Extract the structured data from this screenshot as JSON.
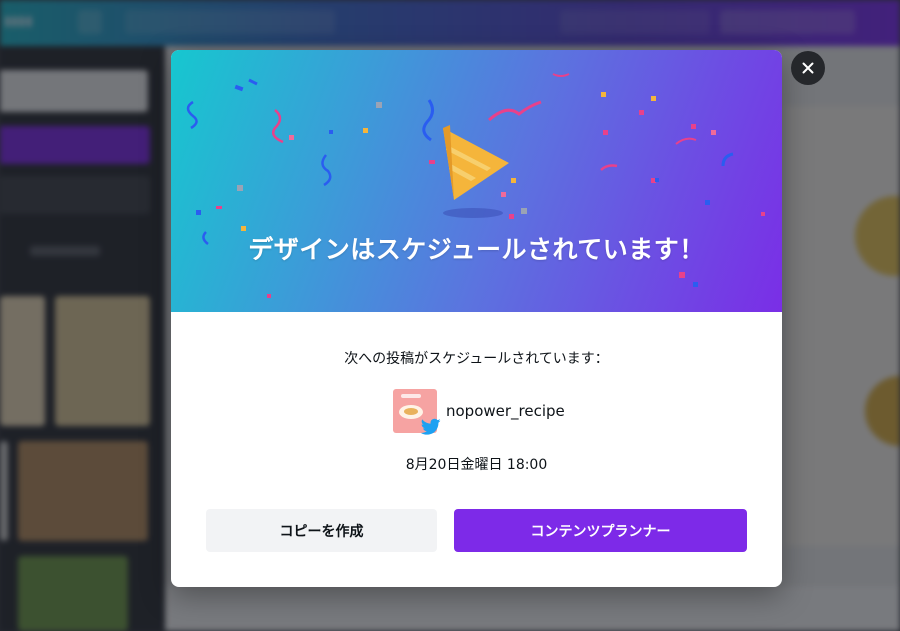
{
  "modal": {
    "title": "デザインはスケジュールされています！",
    "message": "次への投稿がスケジュールされています：",
    "account": {
      "name": "nopower_recipe",
      "platform_icon": "twitter-icon",
      "avatar_color": "#f6a3a2"
    },
    "scheduled_time": "8月20日金曜日 18:00",
    "buttons": {
      "copy": "コピーを作成",
      "planner": "コンテンツプランナー"
    },
    "close_icon": "close-icon"
  },
  "colors": {
    "accent": "#7d2ae8",
    "hero_start": "#16c7cf",
    "hero_end": "#7a2ee6",
    "secondary_button": "#f2f3f5",
    "twitter": "#1da1f2"
  }
}
